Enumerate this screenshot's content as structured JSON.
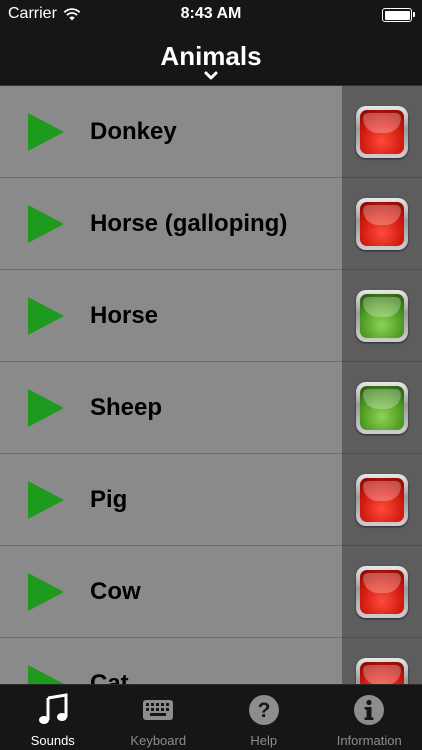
{
  "status": {
    "carrier": "Carrier",
    "time": "8:43 AM"
  },
  "nav": {
    "title": "Animals"
  },
  "sounds": [
    {
      "name": "Donkey",
      "state": "off"
    },
    {
      "name": "Horse (galloping)",
      "state": "off"
    },
    {
      "name": "Horse",
      "state": "on"
    },
    {
      "name": "Sheep",
      "state": "on"
    },
    {
      "name": "Pig",
      "state": "off"
    },
    {
      "name": "Cow",
      "state": "off"
    },
    {
      "name": "Cat",
      "state": "off"
    }
  ],
  "colors": {
    "play": "#1e9a1e",
    "off": "#d21a10",
    "on": "#4d9a22"
  },
  "tabs": [
    {
      "label": "Sounds",
      "icon": "music-note-icon",
      "active": true
    },
    {
      "label": "Keyboard",
      "icon": "keyboard-icon",
      "active": false
    },
    {
      "label": "Help",
      "icon": "help-icon",
      "active": false
    },
    {
      "label": "Information",
      "icon": "info-icon",
      "active": false
    }
  ]
}
